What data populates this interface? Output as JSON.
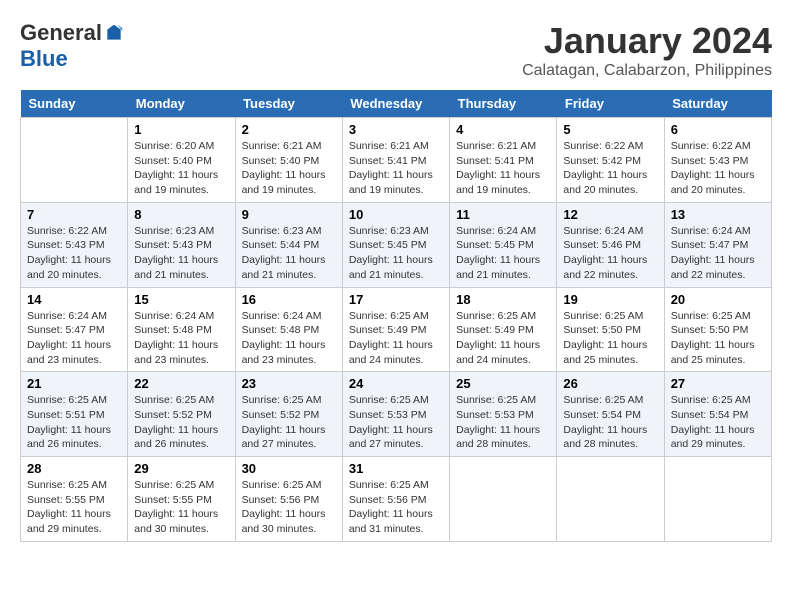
{
  "logo": {
    "general": "General",
    "blue": "Blue"
  },
  "title": "January 2024",
  "location": "Calatagan, Calabarzon, Philippines",
  "weekdays": [
    "Sunday",
    "Monday",
    "Tuesday",
    "Wednesday",
    "Thursday",
    "Friday",
    "Saturday"
  ],
  "weeks": [
    [
      {
        "day": "",
        "sunrise": "",
        "sunset": "",
        "daylight": ""
      },
      {
        "day": "1",
        "sunrise": "Sunrise: 6:20 AM",
        "sunset": "Sunset: 5:40 PM",
        "daylight": "Daylight: 11 hours and 19 minutes."
      },
      {
        "day": "2",
        "sunrise": "Sunrise: 6:21 AM",
        "sunset": "Sunset: 5:40 PM",
        "daylight": "Daylight: 11 hours and 19 minutes."
      },
      {
        "day": "3",
        "sunrise": "Sunrise: 6:21 AM",
        "sunset": "Sunset: 5:41 PM",
        "daylight": "Daylight: 11 hours and 19 minutes."
      },
      {
        "day": "4",
        "sunrise": "Sunrise: 6:21 AM",
        "sunset": "Sunset: 5:41 PM",
        "daylight": "Daylight: 11 hours and 19 minutes."
      },
      {
        "day": "5",
        "sunrise": "Sunrise: 6:22 AM",
        "sunset": "Sunset: 5:42 PM",
        "daylight": "Daylight: 11 hours and 20 minutes."
      },
      {
        "day": "6",
        "sunrise": "Sunrise: 6:22 AM",
        "sunset": "Sunset: 5:43 PM",
        "daylight": "Daylight: 11 hours and 20 minutes."
      }
    ],
    [
      {
        "day": "7",
        "sunrise": "",
        "sunset": "",
        "daylight": ""
      },
      {
        "day": "8",
        "sunrise": "Sunrise: 6:23 AM",
        "sunset": "Sunset: 5:43 PM",
        "daylight": "Daylight: 11 hours and 21 minutes."
      },
      {
        "day": "9",
        "sunrise": "Sunrise: 6:23 AM",
        "sunset": "Sunset: 5:44 PM",
        "daylight": "Daylight: 11 hours and 21 minutes."
      },
      {
        "day": "10",
        "sunrise": "Sunrise: 6:23 AM",
        "sunset": "Sunset: 5:45 PM",
        "daylight": "Daylight: 11 hours and 21 minutes."
      },
      {
        "day": "11",
        "sunrise": "Sunrise: 6:24 AM",
        "sunset": "Sunset: 5:45 PM",
        "daylight": "Daylight: 11 hours and 21 minutes."
      },
      {
        "day": "12",
        "sunrise": "Sunrise: 6:24 AM",
        "sunset": "Sunset: 5:46 PM",
        "daylight": "Daylight: 11 hours and 22 minutes."
      },
      {
        "day": "13",
        "sunrise": "Sunrise: 6:24 AM",
        "sunset": "Sunset: 5:47 PM",
        "daylight": "Daylight: 11 hours and 22 minutes."
      }
    ],
    [
      {
        "day": "14",
        "sunrise": "",
        "sunset": "",
        "daylight": ""
      },
      {
        "day": "15",
        "sunrise": "Sunrise: 6:24 AM",
        "sunset": "Sunset: 5:48 PM",
        "daylight": "Daylight: 11 hours and 23 minutes."
      },
      {
        "day": "16",
        "sunrise": "Sunrise: 6:24 AM",
        "sunset": "Sunset: 5:48 PM",
        "daylight": "Daylight: 11 hours and 23 minutes."
      },
      {
        "day": "17",
        "sunrise": "Sunrise: 6:25 AM",
        "sunset": "Sunset: 5:49 PM",
        "daylight": "Daylight: 11 hours and 24 minutes."
      },
      {
        "day": "18",
        "sunrise": "Sunrise: 6:25 AM",
        "sunset": "Sunset: 5:49 PM",
        "daylight": "Daylight: 11 hours and 24 minutes."
      },
      {
        "day": "19",
        "sunrise": "Sunrise: 6:25 AM",
        "sunset": "Sunset: 5:50 PM",
        "daylight": "Daylight: 11 hours and 25 minutes."
      },
      {
        "day": "20",
        "sunrise": "Sunrise: 6:25 AM",
        "sunset": "Sunset: 5:50 PM",
        "daylight": "Daylight: 11 hours and 25 minutes."
      }
    ],
    [
      {
        "day": "21",
        "sunrise": "",
        "sunset": "",
        "daylight": ""
      },
      {
        "day": "22",
        "sunrise": "Sunrise: 6:25 AM",
        "sunset": "Sunset: 5:52 PM",
        "daylight": "Daylight: 11 hours and 26 minutes."
      },
      {
        "day": "23",
        "sunrise": "Sunrise: 6:25 AM",
        "sunset": "Sunset: 5:52 PM",
        "daylight": "Daylight: 11 hours and 27 minutes."
      },
      {
        "day": "24",
        "sunrise": "Sunrise: 6:25 AM",
        "sunset": "Sunset: 5:53 PM",
        "daylight": "Daylight: 11 hours and 27 minutes."
      },
      {
        "day": "25",
        "sunrise": "Sunrise: 6:25 AM",
        "sunset": "Sunset: 5:53 PM",
        "daylight": "Daylight: 11 hours and 28 minutes."
      },
      {
        "day": "26",
        "sunrise": "Sunrise: 6:25 AM",
        "sunset": "Sunset: 5:54 PM",
        "daylight": "Daylight: 11 hours and 28 minutes."
      },
      {
        "day": "27",
        "sunrise": "Sunrise: 6:25 AM",
        "sunset": "Sunset: 5:54 PM",
        "daylight": "Daylight: 11 hours and 29 minutes."
      }
    ],
    [
      {
        "day": "28",
        "sunrise": "Sunrise: 6:25 AM",
        "sunset": "Sunset: 5:55 PM",
        "daylight": "Daylight: 11 hours and 29 minutes."
      },
      {
        "day": "29",
        "sunrise": "Sunrise: 6:25 AM",
        "sunset": "Sunset: 5:55 PM",
        "daylight": "Daylight: 11 hours and 30 minutes."
      },
      {
        "day": "30",
        "sunrise": "Sunrise: 6:25 AM",
        "sunset": "Sunset: 5:56 PM",
        "daylight": "Daylight: 11 hours and 30 minutes."
      },
      {
        "day": "31",
        "sunrise": "Sunrise: 6:25 AM",
        "sunset": "Sunset: 5:56 PM",
        "daylight": "Daylight: 11 hours and 31 minutes."
      },
      {
        "day": "",
        "sunrise": "",
        "sunset": "",
        "daylight": ""
      },
      {
        "day": "",
        "sunrise": "",
        "sunset": "",
        "daylight": ""
      },
      {
        "day": "",
        "sunrise": "",
        "sunset": "",
        "daylight": ""
      }
    ]
  ],
  "week1_sunday": {
    "sunrise": ""
  },
  "week2_sunday": {
    "sunrise": "Sunrise: 6:22 AM",
    "sunset": "Sunset: 5:43 PM",
    "daylight": "Daylight: 11 hours and 20 minutes."
  },
  "week3_sunday": {
    "sunrise": "Sunrise: 6:24 AM",
    "sunset": "Sunset: 5:47 PM",
    "daylight": "Daylight: 11 hours and 23 minutes."
  },
  "week4_sunday": {
    "sunrise": "Sunrise: 6:25 AM",
    "sunset": "Sunset: 5:51 PM",
    "daylight": "Daylight: 11 hours and 26 minutes."
  }
}
